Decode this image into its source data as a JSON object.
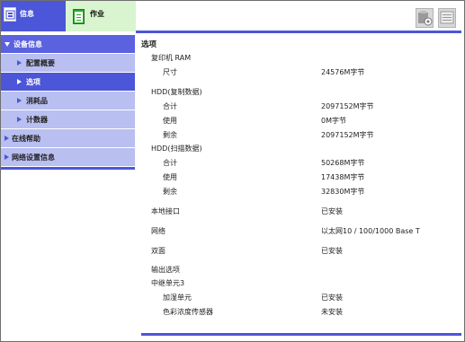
{
  "tabs": {
    "info_label": "信息",
    "job_label": "作业"
  },
  "sidebar": {
    "device_info": "设备信息",
    "config_overview": "配置概要",
    "options": "选项",
    "consumables": "消耗品",
    "counter": "计数器",
    "online_help": "在线帮助",
    "network_settings_info": "网络设置信息"
  },
  "content": {
    "title": "选项",
    "copier_ram": {
      "heading": "复印机 RAM",
      "size_label": "尺寸",
      "size_value": "24576M字节"
    },
    "hdd_copy": {
      "heading": "HDD(复制数据)",
      "total_label": "合计",
      "total_value": "2097152M字节",
      "used_label": "使用",
      "used_value": "0M字节",
      "free_label": "剩余",
      "free_value": "2097152M字节"
    },
    "hdd_scan": {
      "heading": "HDD(扫描数据)",
      "total_label": "合计",
      "total_value": "50268M字节",
      "used_label": "使用",
      "used_value": "17438M字节",
      "free_label": "剩余",
      "free_value": "32830M字节"
    },
    "local_interface": {
      "label": "本地接口",
      "value": "已安装"
    },
    "network": {
      "label": "网络",
      "value": "以太网10 / 100/1000 Base T"
    },
    "duplex": {
      "label": "双面",
      "value": "已安装"
    },
    "output_options": {
      "heading": "输出选项",
      "relay_unit": "中继单元3",
      "humidifier_label": "加湿单元",
      "humidifier_value": "已安装",
      "color_sensor_label": "色彩浓度传感器",
      "color_sensor_value": "未安装"
    }
  },
  "colors": {
    "accent": "#4b56d8",
    "job_tab": "#d9f5cf",
    "nav_light": "#b9bff0"
  },
  "icons": [
    "info-tab-icon",
    "job-tab-icon",
    "device-status-icon",
    "panel-icon"
  ]
}
